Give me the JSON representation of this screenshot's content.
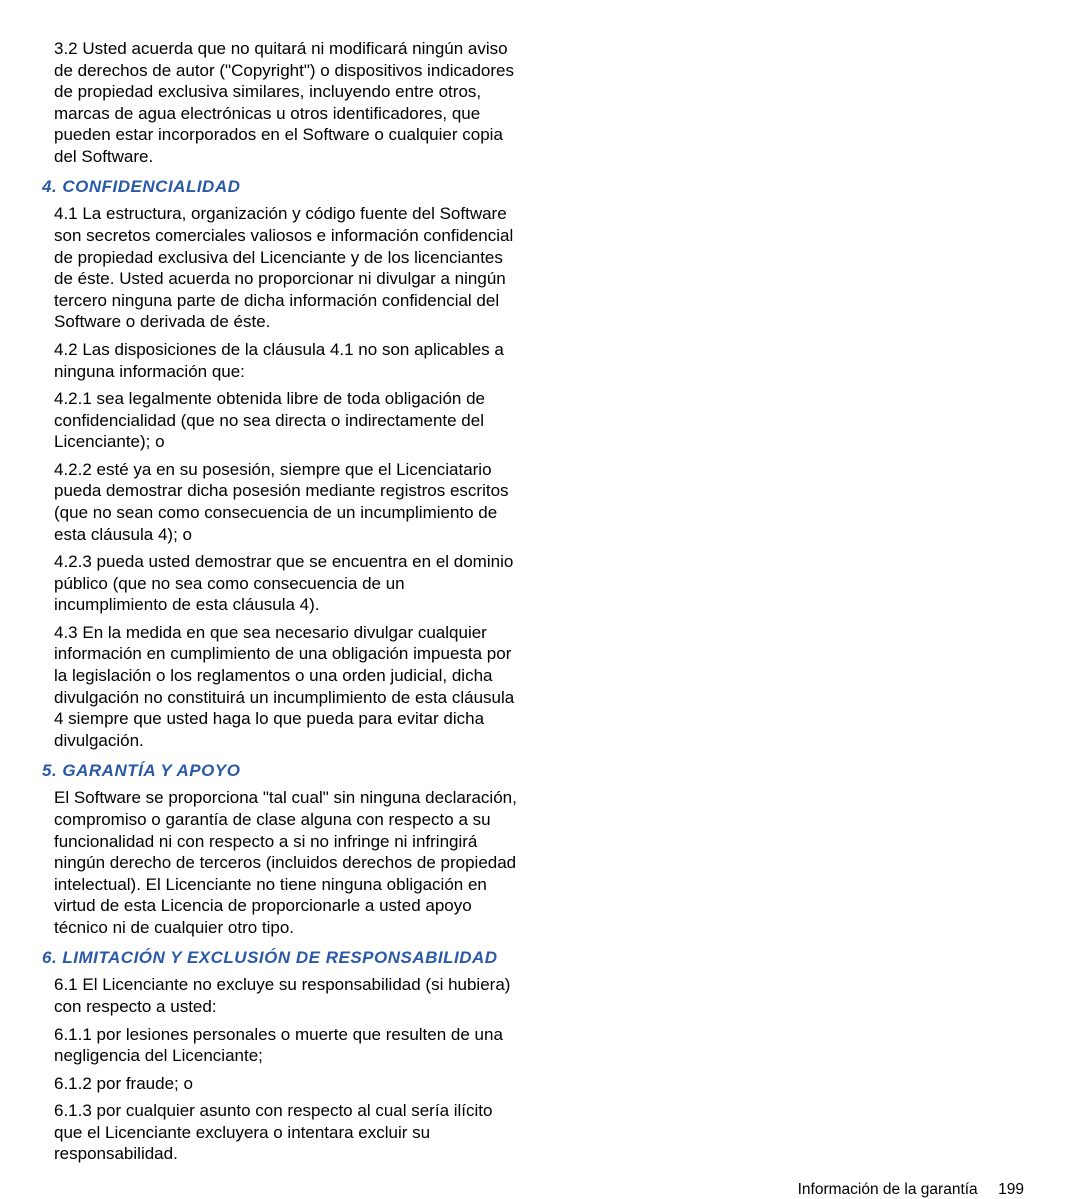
{
  "col1": {
    "p1": "3.2  Usted acuerda que no quitará ni modificará ningún aviso de derechos de autor (\"Copyright\") o dispositivos indicadores de propiedad exclusiva similares, incluyendo entre otros, marcas de agua electrónicas u otros identificadores, que pueden estar incorporados en el Software o cualquier copia del Software.",
    "h1": "4. Confidencialidad",
    "p2": "4.1 La estructura, organización y código fuente del Software son secretos comerciales valiosos e información confidencial de propiedad exclusiva del Licenciante y de los licenciantes de éste. Usted acuerda no proporcionar ni divulgar a ningún tercero ninguna parte de dicha información confidencial del Software o derivada de éste.",
    "p3": "4.2  Las disposiciones de la cláusula 4.1 no son aplicables a ninguna información que:",
    "p4": "4.2.1 sea legalmente obtenida libre de toda obligación de confidencialidad (que no sea directa o indirectamente del Licenciante); o",
    "p5": "4.2.2 esté ya en su posesión, siempre que el Licenciatario pueda demostrar dicha posesión mediante registros escritos (que no sean como consecuencia de un incumplimiento de esta cláusula 4); o",
    "p6": "4.2.3 pueda usted demostrar que se encuentra en el dominio público (que no sea como consecuencia de un incumplimiento de esta cláusula 4)."
  },
  "col2": {
    "p1": "4.3  En la medida en que sea necesario divulgar cualquier información en cumplimiento de una obligación impuesta por la legislación o los reglamentos o una orden judicial, dicha divulgación no constituirá un incumplimiento de esta cláusula 4 siempre que usted haga lo que pueda para evitar dicha divulgación.",
    "h1": "5. Garantía y apoyo",
    "p2": "El Software se proporciona \"tal cual\" sin ninguna declaración, compromiso o garantía de clase alguna con respecto a su funcionalidad ni con respecto a si no infringe ni infringirá ningún derecho de terceros (incluidos derechos de propiedad intelectual). El Licenciante no tiene ninguna obligación en virtud de esta Licencia de proporcionarle a usted apoyo técnico ni de cualquier otro tipo.",
    "h2": "6. Limitación y exclusión de responsabilidad",
    "p3": "6.1  El Licenciante no excluye su responsabilidad (si hubiera) con respecto a usted:",
    "p4": "6.1.1  por lesiones personales o muerte que resulten de una negligencia del Licenciante;",
    "p5": "6.1.2 por fraude; o",
    "p6": "6.1.3 por cualquier asunto con respecto al cual sería ilícito que el Licenciante excluyera o intentara excluir su responsabilidad."
  },
  "footer": {
    "label": "Información de la garantía",
    "page": "199"
  }
}
